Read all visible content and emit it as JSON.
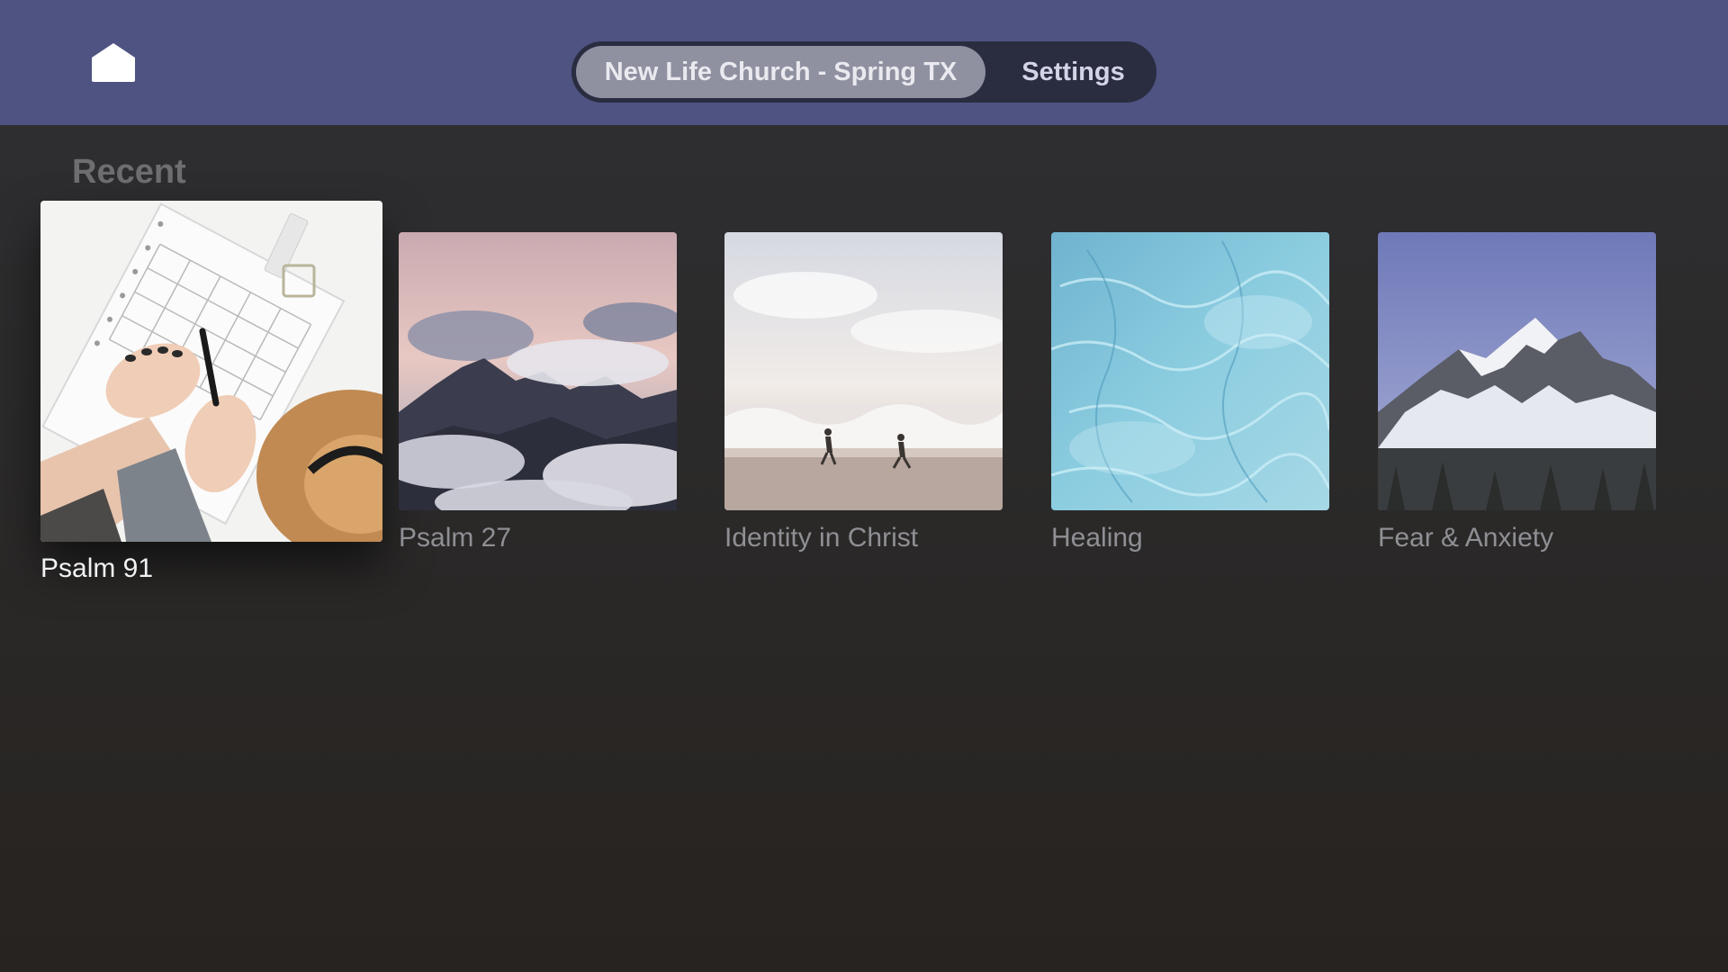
{
  "header": {
    "home_icon": "house-icon",
    "segments": [
      {
        "label": "New Life Church - Spring TX",
        "selected": true
      },
      {
        "label": "Settings",
        "selected": false
      }
    ]
  },
  "recent": {
    "title": "Recent",
    "items": [
      {
        "label": "Psalm 91",
        "focused": true,
        "image": "hands-writing-planner-with-hat"
      },
      {
        "label": "Psalm 27",
        "focused": false,
        "image": "mountain-peaks-above-clouds"
      },
      {
        "label": "Identity in Christ",
        "focused": false,
        "image": "people-running-on-beach-waves"
      },
      {
        "label": "Healing",
        "focused": false,
        "image": "blue-water-surface"
      },
      {
        "label": "Fear & Anxiety",
        "focused": false,
        "image": "snowy-mountain-range"
      }
    ]
  },
  "colors": {
    "topbar": "#4f5381",
    "segment_track": "#2a2c40",
    "segment_selected": "#8f90a0",
    "background": "#2b2a2a"
  }
}
